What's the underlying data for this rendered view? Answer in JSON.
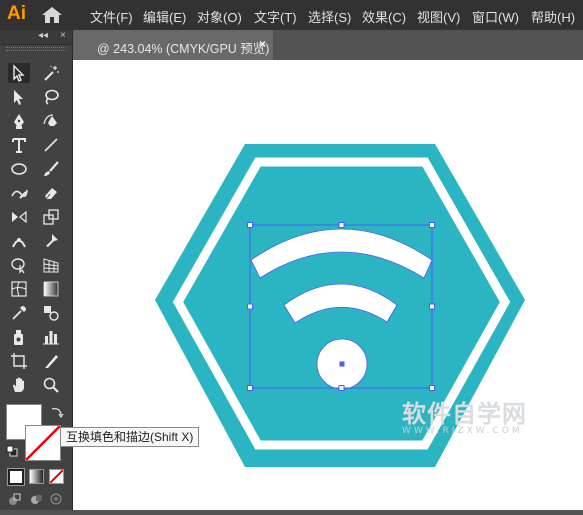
{
  "app": {
    "logo_text": "Ai"
  },
  "menu": {
    "items": [
      "文件(F)",
      "编辑(E)",
      "对象(O)",
      "文字(T)",
      "选择(S)",
      "效果(C)",
      "视图(V)",
      "窗口(W)",
      "帮助(H)"
    ]
  },
  "document_tab": {
    "title": "@ 243.04% (CMYK/GPU 预览)",
    "close_glyph": "×"
  },
  "toolbar": {
    "collapse_glyph": "◂◂",
    "close_glyph": "×"
  },
  "tooltip": {
    "text": "互换填色和描边(Shift X)"
  },
  "watermark": {
    "main": "软件自学网",
    "sub": "WWW.RJZXW.COM"
  },
  "colors": {
    "hexagon": "#2bb5c2",
    "selection": "#4a5cff",
    "white": "#ffffff"
  },
  "icons": [
    "selection-tool-icon",
    "direct-selection-tool-icon",
    "magic-wand-tool-icon",
    "lasso-tool-icon",
    "pen-tool-icon",
    "curvature-tool-icon",
    "type-tool-icon",
    "line-tool-icon",
    "ellipse-tool-icon",
    "paintbrush-tool-icon",
    "shaper-tool-icon",
    "eraser-tool-icon",
    "rotate-tool-icon",
    "scale-tool-icon",
    "width-tool-icon",
    "puppet-warp-tool-icon",
    "shape-builder-tool-icon",
    "perspective-grid-tool-icon",
    "mesh-tool-icon",
    "gradient-tool-icon",
    "eyedropper-tool-icon",
    "blend-tool-icon",
    "symbol-sprayer-tool-icon",
    "column-graph-tool-icon",
    "artboard-tool-icon",
    "slice-tool-icon",
    "hand-tool-icon",
    "zoom-tool-icon"
  ]
}
